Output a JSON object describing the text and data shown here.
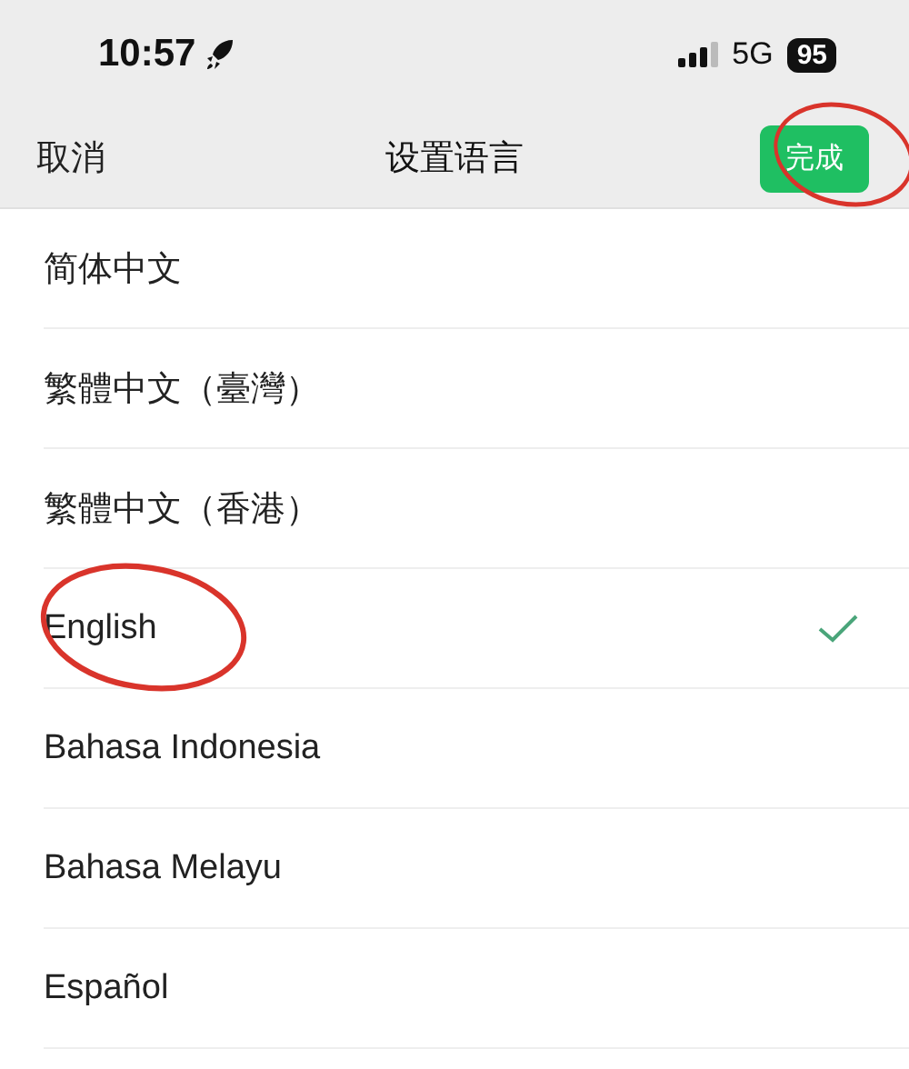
{
  "status_bar": {
    "time": "10:57",
    "network": "5G",
    "battery": "95"
  },
  "nav": {
    "cancel": "取消",
    "title": "设置语言",
    "done": {
      "label": "完成",
      "circled": true
    }
  },
  "languages": [
    {
      "label": "简体中文",
      "selected": false,
      "circled": false
    },
    {
      "label": "繁體中文（臺灣）",
      "selected": false,
      "circled": false
    },
    {
      "label": "繁體中文（香港）",
      "selected": false,
      "circled": false
    },
    {
      "label": "English",
      "selected": true,
      "circled": true
    },
    {
      "label": "Bahasa Indonesia",
      "selected": false,
      "circled": false
    },
    {
      "label": "Bahasa Melayu",
      "selected": false,
      "circled": false
    },
    {
      "label": "Español",
      "selected": false,
      "circled": false
    }
  ]
}
